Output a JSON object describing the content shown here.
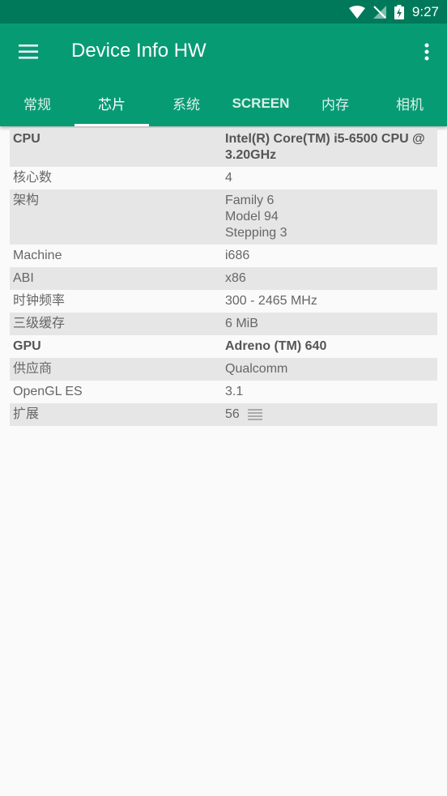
{
  "status": {
    "time": "9:27"
  },
  "appbar": {
    "title": "Device Info HW"
  },
  "tabs": [
    {
      "label": "常规"
    },
    {
      "label": "芯片"
    },
    {
      "label": "系统"
    },
    {
      "label": "SCREEN"
    },
    {
      "label": "内存"
    },
    {
      "label": "相机"
    }
  ],
  "rows": [
    {
      "label": "CPU",
      "value": "Intel(R) Core(TM) i5-6500 CPU @\n3.20GHz"
    },
    {
      "label": "核心数",
      "value": "4"
    },
    {
      "label": "架构",
      "value": "Family 6\nModel 94\nStepping 3"
    },
    {
      "label": "Machine",
      "value": "i686"
    },
    {
      "label": "ABI",
      "value": "x86"
    },
    {
      "label": "时钟频率",
      "value": "300 - 2465 MHz"
    },
    {
      "label": "三级缓存",
      "value": "6 MiB"
    },
    {
      "label": "GPU",
      "value": "Adreno (TM) 640"
    },
    {
      "label": "供应商",
      "value": "Qualcomm"
    },
    {
      "label": "OpenGL ES",
      "value": "3.1"
    },
    {
      "label": "扩展",
      "value": "56"
    }
  ],
  "colors": {
    "status_bar": "#00795a",
    "app_bar": "#079b74",
    "row_shade": "#e6e6e6"
  }
}
